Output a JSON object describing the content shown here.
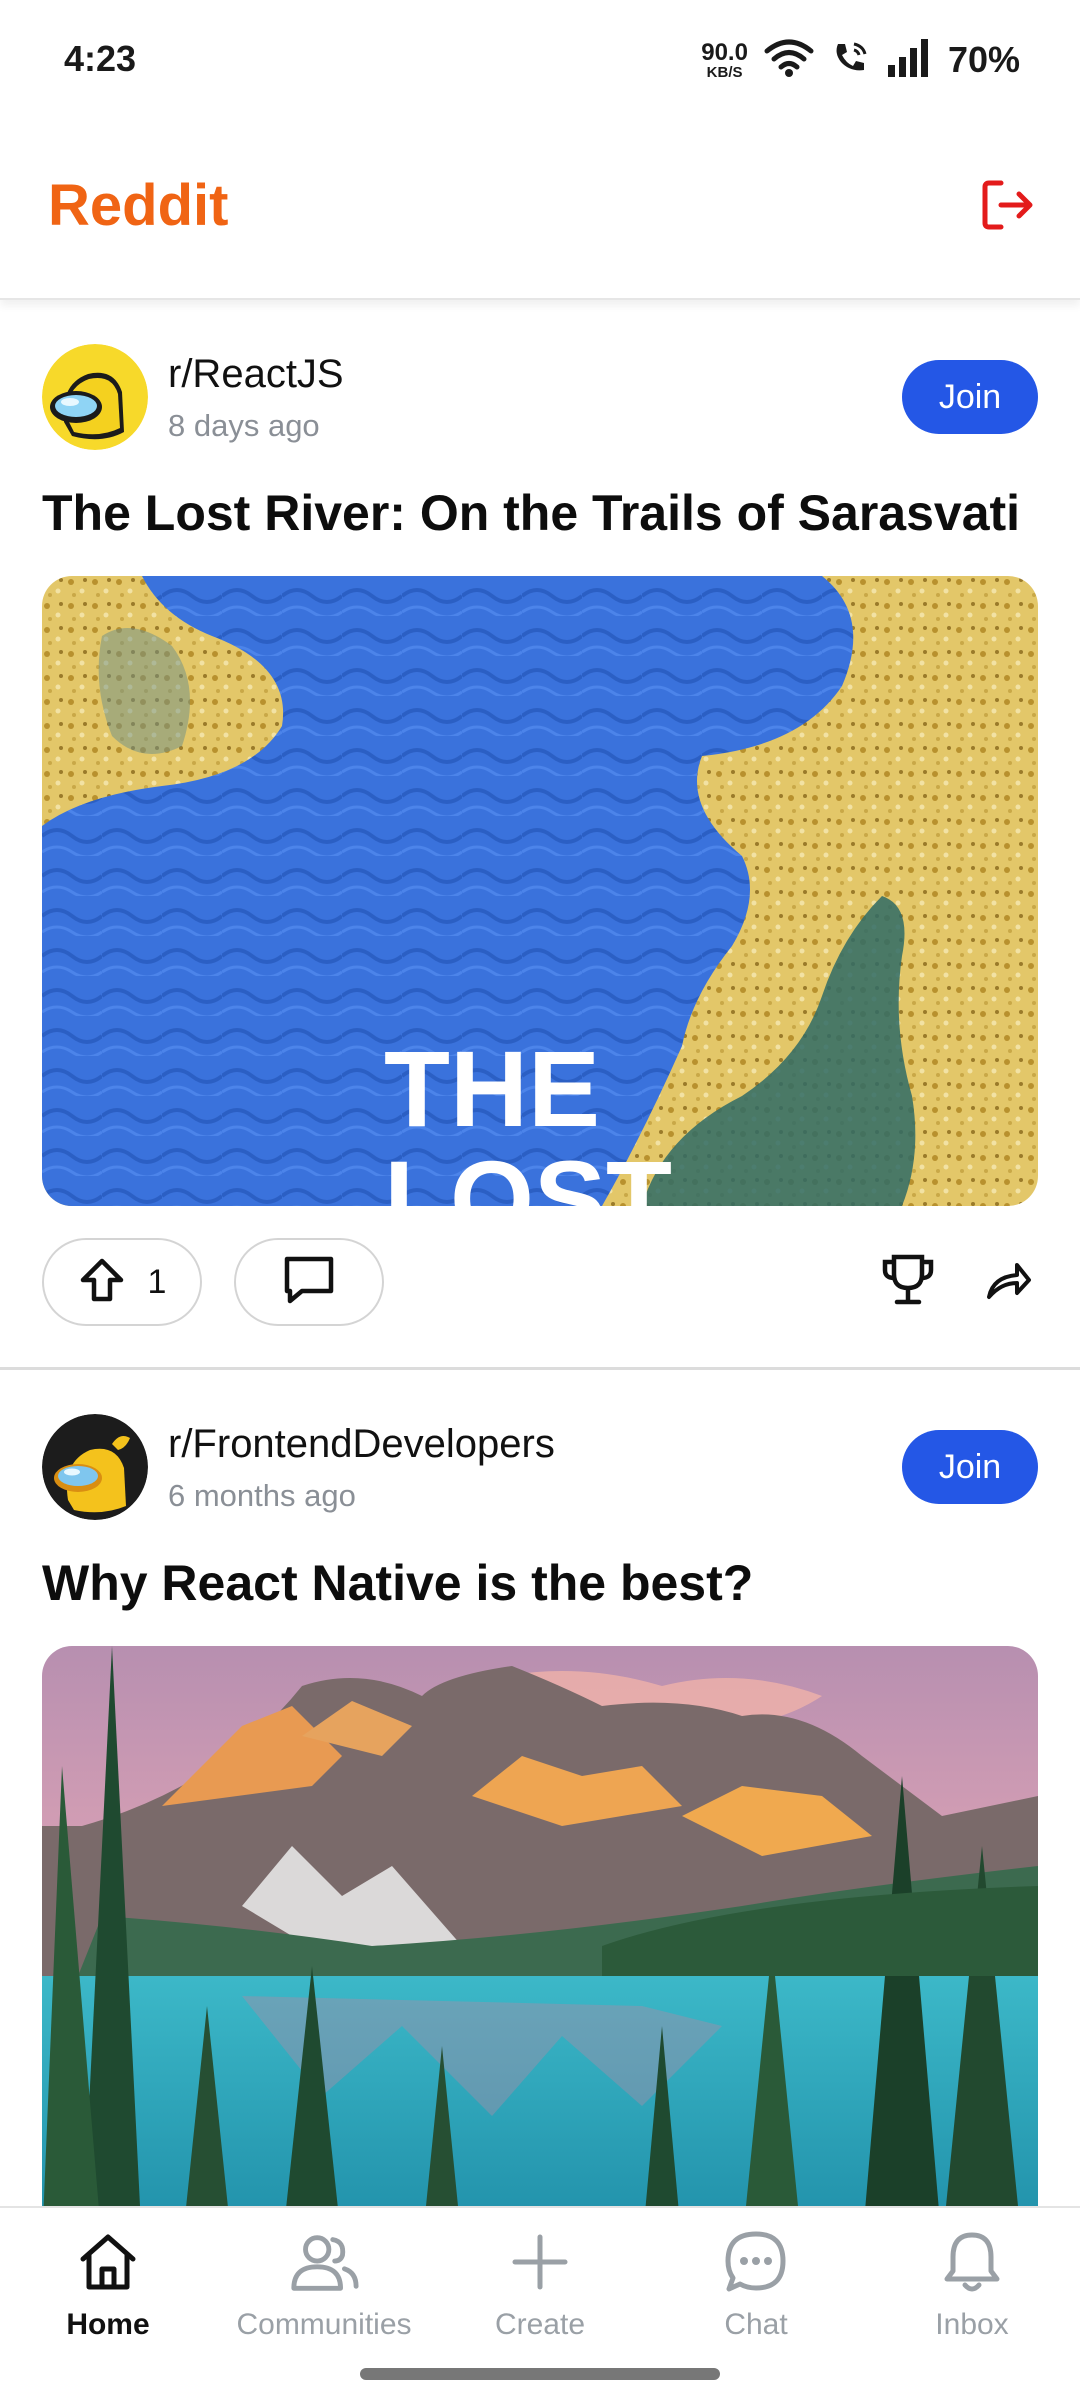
{
  "status_bar": {
    "time": "4:23",
    "net_speed_value": "90.0",
    "net_speed_unit": "KB/S",
    "battery": "70%"
  },
  "header": {
    "title": "Reddit",
    "title_color": "#f06414",
    "logout_icon": "logout-icon"
  },
  "posts": [
    {
      "subreddit": "r/ReactJS",
      "time": "8 days ago",
      "join_label": "Join",
      "title": "The Lost River: On the Trails of Sarasvati",
      "image_text": "THE LOST",
      "upvotes": "1",
      "avatar_color": "#f7d92a"
    },
    {
      "subreddit": "r/FrontendDevelopers",
      "time": "6 months ago",
      "join_label": "Join",
      "title": "Why React Native is the best?",
      "avatar_color": "#1c1c1c"
    }
  ],
  "bottom_nav": {
    "items": [
      {
        "label": "Home",
        "icon": "home-icon",
        "active": true
      },
      {
        "label": "Communities",
        "icon": "communities-icon",
        "active": false
      },
      {
        "label": "Create",
        "icon": "plus-icon",
        "active": false
      },
      {
        "label": "Chat",
        "icon": "chat-icon",
        "active": false
      },
      {
        "label": "Inbox",
        "icon": "bell-icon",
        "active": false
      }
    ]
  },
  "colors": {
    "accent": "#f06414",
    "join_button": "#2457e6"
  }
}
